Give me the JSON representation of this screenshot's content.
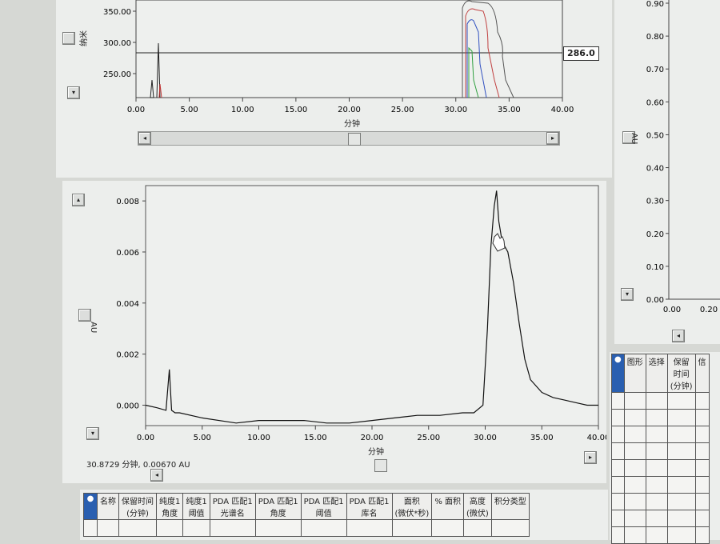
{
  "top_panel": {
    "y_axis_label": "纳米",
    "x_axis_label": "分钟",
    "y_ticks": [
      "350.00",
      "300.00",
      "250.00"
    ],
    "x_ticks": [
      "0.00",
      "5.00",
      "10.00",
      "15.00",
      "20.00",
      "25.00",
      "30.00",
      "35.00",
      "40.00"
    ],
    "wavelength_value": "286.0"
  },
  "chromatogram": {
    "y_axis_label": "AU",
    "x_axis_label": "分钟",
    "status_readout": "30.8729 分钟, 0.00670 AU",
    "chart_data": {
      "type": "line",
      "xlabel": "分钟",
      "ylabel": "AU",
      "xlim": [
        0,
        40
      ],
      "ylim": [
        -0.0008,
        0.0086
      ],
      "x_ticks": [
        "0.00",
        "5.00",
        "10.00",
        "15.00",
        "20.00",
        "25.00",
        "30.00",
        "35.00",
        "40.00"
      ],
      "y_ticks": [
        "0.000",
        "0.002",
        "0.004",
        "0.006",
        "0.008"
      ],
      "series": [
        {
          "x": [
            0,
            1,
            1.8,
            2.1,
            2.3,
            2.6,
            3,
            5,
            8,
            10,
            12,
            14,
            16,
            18,
            20,
            22,
            24,
            26,
            28,
            29,
            29.8,
            30.2,
            30.5,
            30.8,
            31.0,
            31.2,
            31.5,
            32,
            32.5,
            33,
            33.5,
            34,
            35,
            36,
            37,
            38,
            39,
            40
          ],
          "y": [
            0.0,
            -0.0001,
            -0.0002,
            0.0014,
            -0.0002,
            -0.0003,
            -0.0003,
            -0.0005,
            -0.0007,
            -0.0006,
            -0.0006,
            -0.0006,
            -0.0007,
            -0.0007,
            -0.0006,
            -0.0005,
            -0.0004,
            -0.0004,
            -0.0003,
            -0.0003,
            0.0,
            0.003,
            0.0062,
            0.0078,
            0.0084,
            0.0072,
            0.0064,
            0.006,
            0.0048,
            0.0032,
            0.0018,
            0.001,
            0.0005,
            0.0003,
            0.0002,
            0.0001,
            0.0,
            0.0
          ]
        }
      ]
    }
  },
  "right_panel": {
    "y_axis_label": "AU",
    "y_ticks": [
      "0.90",
      "0.80",
      "0.70",
      "0.60",
      "0.50",
      "0.40",
      "0.30",
      "0.20",
      "0.10",
      "0.00"
    ],
    "x_ticks": [
      "0.00",
      "0.20"
    ]
  },
  "peak_table": {
    "headers": [
      "名称",
      "保留时间\n(分钟)",
      "纯度1\n角度",
      "纯度1\n阈值",
      "PDA 匹配1\n光谱名",
      "PDA 匹配1\n角度",
      "PDA 匹配1\n阈值",
      "PDA 匹配1\n库名",
      "面积\n(微伏*秒)",
      "% 面积",
      "高度\n(微伏)",
      "积分类型"
    ]
  },
  "right_table": {
    "headers": [
      "图形",
      "选择",
      "保留\n时间\n(分钟)",
      "信"
    ]
  },
  "colors": {
    "background": "#d6d8d4",
    "plot_bg": "#eef0ee",
    "trace": "#111111"
  }
}
